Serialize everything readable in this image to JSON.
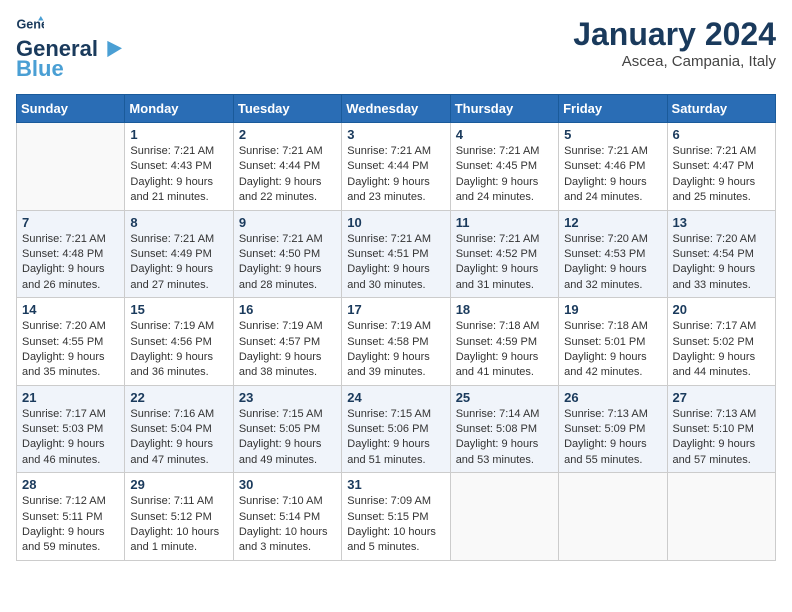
{
  "header": {
    "logo_general": "General",
    "logo_blue": "Blue",
    "month": "January 2024",
    "location": "Ascea, Campania, Italy"
  },
  "weekdays": [
    "Sunday",
    "Monday",
    "Tuesday",
    "Wednesday",
    "Thursday",
    "Friday",
    "Saturday"
  ],
  "weeks": [
    [
      {
        "day": "",
        "info": ""
      },
      {
        "day": "1",
        "info": "Sunrise: 7:21 AM\nSunset: 4:43 PM\nDaylight: 9 hours\nand 21 minutes."
      },
      {
        "day": "2",
        "info": "Sunrise: 7:21 AM\nSunset: 4:44 PM\nDaylight: 9 hours\nand 22 minutes."
      },
      {
        "day": "3",
        "info": "Sunrise: 7:21 AM\nSunset: 4:44 PM\nDaylight: 9 hours\nand 23 minutes."
      },
      {
        "day": "4",
        "info": "Sunrise: 7:21 AM\nSunset: 4:45 PM\nDaylight: 9 hours\nand 24 minutes."
      },
      {
        "day": "5",
        "info": "Sunrise: 7:21 AM\nSunset: 4:46 PM\nDaylight: 9 hours\nand 24 minutes."
      },
      {
        "day": "6",
        "info": "Sunrise: 7:21 AM\nSunset: 4:47 PM\nDaylight: 9 hours\nand 25 minutes."
      }
    ],
    [
      {
        "day": "7",
        "info": "Sunrise: 7:21 AM\nSunset: 4:48 PM\nDaylight: 9 hours\nand 26 minutes."
      },
      {
        "day": "8",
        "info": "Sunrise: 7:21 AM\nSunset: 4:49 PM\nDaylight: 9 hours\nand 27 minutes."
      },
      {
        "day": "9",
        "info": "Sunrise: 7:21 AM\nSunset: 4:50 PM\nDaylight: 9 hours\nand 28 minutes."
      },
      {
        "day": "10",
        "info": "Sunrise: 7:21 AM\nSunset: 4:51 PM\nDaylight: 9 hours\nand 30 minutes."
      },
      {
        "day": "11",
        "info": "Sunrise: 7:21 AM\nSunset: 4:52 PM\nDaylight: 9 hours\nand 31 minutes."
      },
      {
        "day": "12",
        "info": "Sunrise: 7:20 AM\nSunset: 4:53 PM\nDaylight: 9 hours\nand 32 minutes."
      },
      {
        "day": "13",
        "info": "Sunrise: 7:20 AM\nSunset: 4:54 PM\nDaylight: 9 hours\nand 33 minutes."
      }
    ],
    [
      {
        "day": "14",
        "info": "Sunrise: 7:20 AM\nSunset: 4:55 PM\nDaylight: 9 hours\nand 35 minutes."
      },
      {
        "day": "15",
        "info": "Sunrise: 7:19 AM\nSunset: 4:56 PM\nDaylight: 9 hours\nand 36 minutes."
      },
      {
        "day": "16",
        "info": "Sunrise: 7:19 AM\nSunset: 4:57 PM\nDaylight: 9 hours\nand 38 minutes."
      },
      {
        "day": "17",
        "info": "Sunrise: 7:19 AM\nSunset: 4:58 PM\nDaylight: 9 hours\nand 39 minutes."
      },
      {
        "day": "18",
        "info": "Sunrise: 7:18 AM\nSunset: 4:59 PM\nDaylight: 9 hours\nand 41 minutes."
      },
      {
        "day": "19",
        "info": "Sunrise: 7:18 AM\nSunset: 5:01 PM\nDaylight: 9 hours\nand 42 minutes."
      },
      {
        "day": "20",
        "info": "Sunrise: 7:17 AM\nSunset: 5:02 PM\nDaylight: 9 hours\nand 44 minutes."
      }
    ],
    [
      {
        "day": "21",
        "info": "Sunrise: 7:17 AM\nSunset: 5:03 PM\nDaylight: 9 hours\nand 46 minutes."
      },
      {
        "day": "22",
        "info": "Sunrise: 7:16 AM\nSunset: 5:04 PM\nDaylight: 9 hours\nand 47 minutes."
      },
      {
        "day": "23",
        "info": "Sunrise: 7:15 AM\nSunset: 5:05 PM\nDaylight: 9 hours\nand 49 minutes."
      },
      {
        "day": "24",
        "info": "Sunrise: 7:15 AM\nSunset: 5:06 PM\nDaylight: 9 hours\nand 51 minutes."
      },
      {
        "day": "25",
        "info": "Sunrise: 7:14 AM\nSunset: 5:08 PM\nDaylight: 9 hours\nand 53 minutes."
      },
      {
        "day": "26",
        "info": "Sunrise: 7:13 AM\nSunset: 5:09 PM\nDaylight: 9 hours\nand 55 minutes."
      },
      {
        "day": "27",
        "info": "Sunrise: 7:13 AM\nSunset: 5:10 PM\nDaylight: 9 hours\nand 57 minutes."
      }
    ],
    [
      {
        "day": "28",
        "info": "Sunrise: 7:12 AM\nSunset: 5:11 PM\nDaylight: 9 hours\nand 59 minutes."
      },
      {
        "day": "29",
        "info": "Sunrise: 7:11 AM\nSunset: 5:12 PM\nDaylight: 10 hours\nand 1 minute."
      },
      {
        "day": "30",
        "info": "Sunrise: 7:10 AM\nSunset: 5:14 PM\nDaylight: 10 hours\nand 3 minutes."
      },
      {
        "day": "31",
        "info": "Sunrise: 7:09 AM\nSunset: 5:15 PM\nDaylight: 10 hours\nand 5 minutes."
      },
      {
        "day": "",
        "info": ""
      },
      {
        "day": "",
        "info": ""
      },
      {
        "day": "",
        "info": ""
      }
    ]
  ]
}
